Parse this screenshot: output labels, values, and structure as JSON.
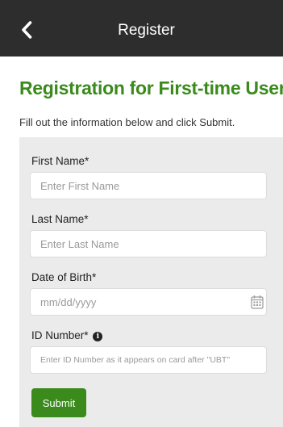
{
  "header": {
    "title": "Register",
    "back_icon": "chevron-left-icon"
  },
  "page": {
    "heading": "Registration for First-time Users",
    "intro": "Fill out the information below and click Submit."
  },
  "form": {
    "first_name": {
      "label": "First Name*",
      "placeholder": "Enter First Name",
      "value": ""
    },
    "last_name": {
      "label": "Last Name*",
      "placeholder": "Enter Last Name",
      "value": ""
    },
    "dob": {
      "label": "Date of Birth*",
      "placeholder": "mm/dd/yyyy",
      "value": "",
      "icon": "calendar-icon"
    },
    "id_number": {
      "label": "ID Number*",
      "placeholder": "Enter ID Number as it appears on card after \"UBT\"",
      "value": "",
      "info_icon": "info-icon",
      "info_glyph": "i"
    },
    "submit_label": "Submit"
  },
  "colors": {
    "accent": "#3a8a1c",
    "header_bg": "#2d2d2d",
    "panel_bg": "#ebebeb"
  }
}
